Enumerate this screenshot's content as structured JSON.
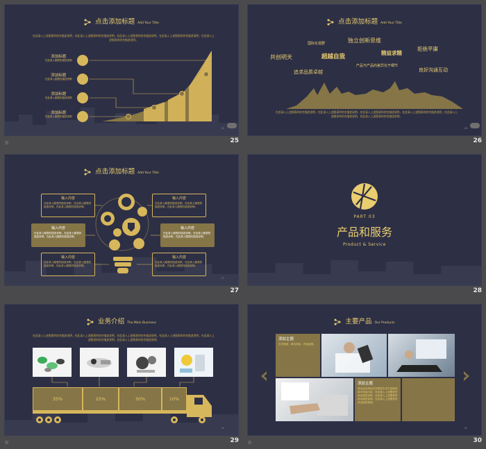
{
  "colors": {
    "accent": "#d7b75b",
    "background": "#2d2f45",
    "panel": "#857547"
  },
  "slides": [
    {
      "page": "25",
      "title": "点击添加标题",
      "subtitle": "Add Your Title",
      "intro": "在此录入上述图表的综合描述说明，在此录入上述图表的综合描述说明，在此录入上述图表的综合描述说明，在此录入上述图表的综合描述说明，在此录入上述图表的综合描述说明。",
      "items": [
        {
          "label": "添加标题",
          "desc": "在此录入图表的描述说明",
          "icon": "home-icon"
        },
        {
          "label": "添加标题",
          "desc": "在此录入图表的描述说明",
          "icon": "battery-icon"
        },
        {
          "label": "添加标题",
          "desc": "在此录入图表的描述说明",
          "icon": "lock-icon"
        },
        {
          "label": "添加标题",
          "desc": "在此录入图表的描述说明",
          "icon": "truck-icon"
        }
      ],
      "small_num": "25"
    },
    {
      "page": "26",
      "title": "点击添加标题",
      "subtitle": "Add Your Title",
      "words": [
        "国际化视野",
        "独立创新思维",
        "共创明天",
        "超越自我",
        "精益求精",
        "拒绝平庸",
        "产品与产品的差异在于细节",
        "追求品质卓越",
        "良好沟通互动"
      ],
      "caption": "在此录入上述图表的综合描述说明，在此录入上述图表的综合描述说明，在此录入上述图表的综合描述说明，在此录入上述图表的综合描述说明，在此录入上述图表的综合描述说明，在此录入上述图表的综合描述说明。",
      "small_num": "26"
    },
    {
      "page": "27",
      "title": "点击添加标题",
      "subtitle": "Add Your Title",
      "boxes": [
        {
          "head": "输入内容",
          "body": "在此录入图表的描述说明，在此录入图表的描述说明，在此录入图表的描述说明。"
        },
        {
          "head": "输入内容",
          "body": "在此录入图表的描述说明，在此录入图表的描述说明，在此录入图表的描述说明。"
        },
        {
          "head": "输入内容",
          "body": "在此录入图表的描述说明，在此录入图表的描述说明，在此录入图表的描述说明。"
        },
        {
          "head": "输入内容",
          "body": "在此录入图表的描述说明，在此录入图表的描述说明，在此录入图表的描述说明。"
        },
        {
          "head": "输入内容",
          "body": "在此录入图表的描述说明，在此录入图表的描述说明，在此录入图表的描述说明。"
        },
        {
          "head": "输入内容",
          "body": "在此录入图表的描述说明，在此录入图表的描述说明，在此录入图表的描述说明。"
        }
      ],
      "small_num": "27"
    },
    {
      "page": "28",
      "part": "PART  03",
      "title": "产品和服务",
      "subtitle": "Product & Service"
    },
    {
      "page": "29",
      "title": "业务介绍",
      "subtitle": "The Main Business",
      "intro": "在此录入上述图表的综合描述说明，在此录入上述图表的综合描述说明，在此录入上述图表的综合描述说明，在此录入上述图表的综合描述说明，在此录入上述图表的综合描述说明，在此录入上述图表的综合描述说明。",
      "percents": [
        "35%",
        "25%",
        "30%",
        "10%"
      ],
      "small_num": "29"
    },
    {
      "page": "30",
      "title": "主要产品",
      "subtitle": "Our Products",
      "card1": {
        "head": "添加主题",
        "body": "文字描述，单击添加，内容此框。"
      },
      "card2": {
        "head": "添加主题",
        "body": "单击此处添加文本描述文字内容简述单击添加内容，在此录入上述图表的综合描述说明，在此录入上述图表的综合描述说明，在此录入上述图表的综合描述说明。"
      },
      "small_num": "30"
    }
  ]
}
